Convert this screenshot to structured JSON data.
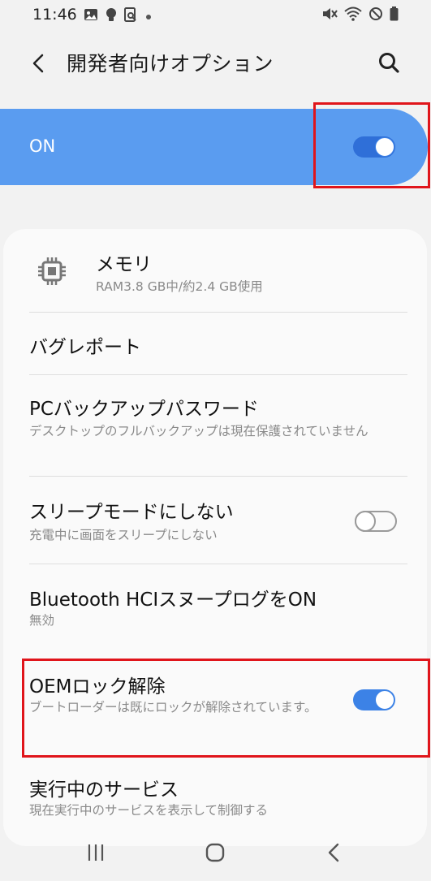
{
  "status_bar": {
    "time": "11:46",
    "left_icons": [
      "gallery-icon",
      "lightbulb-icon",
      "document-search-icon",
      "dot-icon"
    ],
    "right_icons": [
      "mute-icon",
      "wifi-icon",
      "do-not-disturb-icon",
      "battery-icon"
    ]
  },
  "app_bar": {
    "title": "開発者向けオプション"
  },
  "master_switch": {
    "label": "ON",
    "state": "on"
  },
  "settings": [
    {
      "title": "メモリ",
      "subtitle": "RAM3.8 GB中/約2.4 GB使用",
      "icon": "memory-chip-icon"
    },
    {
      "title": "バグレポート"
    },
    {
      "title": "PCバックアップパスワード",
      "subtitle": "デスクトップのフルバックアップは現在保護されていません"
    },
    {
      "title": "スリープモードにしない",
      "subtitle": "充電中に画面をスリープにしない",
      "toggle": "off"
    },
    {
      "title": "Bluetooth HCIスヌープログをON",
      "subtitle": "無効"
    },
    {
      "title": "OEMロック解除",
      "subtitle": "ブートローダーは既にロックが解除されています。",
      "toggle": "on"
    },
    {
      "title": "実行中のサービス",
      "subtitle": "現在実行中のサービスを表示して制御する"
    }
  ],
  "nav_bar": {
    "icons": [
      "recent-apps-icon",
      "home-icon",
      "back-nav-icon"
    ]
  },
  "colors": {
    "accent": "#3c82e6",
    "master_bg": "#5a9cf0",
    "highlight": "#e0151b"
  }
}
